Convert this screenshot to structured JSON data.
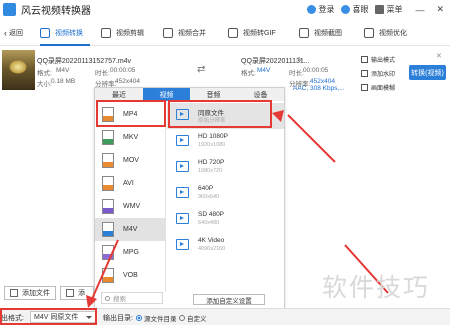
{
  "app": {
    "title": "风云视频转换器"
  },
  "titlebar": {
    "login": "登录",
    "favorites": "喜眼",
    "menu": "菜单",
    "minimize": "—",
    "close": "✕"
  },
  "toolbar": {
    "back": "返回",
    "tools": [
      {
        "label": "视频转换",
        "active": true
      },
      {
        "label": "视频剪辑",
        "active": false
      },
      {
        "label": "视频合并",
        "active": false
      },
      {
        "label": "视频转GIF",
        "active": false
      },
      {
        "label": "视频截图",
        "active": false
      },
      {
        "label": "视频优化",
        "active": false
      }
    ]
  },
  "file": {
    "src_name": "QQ录屏20220113152757.m4v",
    "src_format_label": "格式:",
    "src_format": "M4V",
    "src_duration_label": "时长:",
    "src_duration": "00:00:05",
    "src_size_label": "大小:",
    "src_size": "0.18 MB",
    "src_res_label": "分辨率:",
    "src_res": "452x404",
    "dst_name": "QQ录屏2022011131...",
    "dst_format_label": "格式:",
    "dst_format": "M4V",
    "dst_duration_label": "时长:",
    "dst_duration": "00:00:05",
    "dst_res_label": "分辨率:",
    "dst_res": "452x404",
    "dst_codec": "AAC, 308 Kbps,...",
    "actions": [
      "输出模式",
      "添加水印",
      "画面模糊"
    ],
    "convert_button": "转换(视频)"
  },
  "dialog": {
    "tabs": [
      {
        "label": "最近",
        "active": false
      },
      {
        "label": "视频",
        "active": true
      },
      {
        "label": "音频",
        "active": false
      },
      {
        "label": "设备",
        "active": false
      }
    ],
    "formats": [
      {
        "label": "MP4",
        "color": "#e88a2f",
        "selected": false
      },
      {
        "label": "MKV",
        "color": "#3f9c5c",
        "selected": false
      },
      {
        "label": "MOV",
        "color": "#e88a2f",
        "selected": false
      },
      {
        "label": "AVI",
        "color": "#e88a2f",
        "selected": false
      },
      {
        "label": "WMV",
        "color": "#7a5ac9",
        "selected": false
      },
      {
        "label": "M4V",
        "color": "#2b7fd9",
        "selected": true
      },
      {
        "label": "MPG",
        "color": "#8c6bd6",
        "selected": false
      },
      {
        "label": "VOB",
        "color": "#e88a2f",
        "selected": false
      }
    ],
    "resolutions": [
      {
        "name": "同原文件",
        "sub": "原始分辨率",
        "selected": true
      },
      {
        "name": "HD 1080P",
        "sub": "1920x1080",
        "selected": false
      },
      {
        "name": "HD 720P",
        "sub": "1080x720",
        "selected": false
      },
      {
        "name": "640P",
        "sub": "960x640",
        "selected": false
      },
      {
        "name": "SD 480P",
        "sub": "640x480",
        "selected": false
      },
      {
        "name": "4K Video",
        "sub": "4096x2160",
        "selected": false
      }
    ],
    "search_placeholder": "搜索",
    "add_custom": "添加自定义设置"
  },
  "bottom": {
    "add_file": "添加文件",
    "add_folder": "添",
    "output_format_label": "出格式:",
    "output_format_value": "M4V 同原文件",
    "output_dir_label": "输出目录:",
    "radio_source": "源文件目录",
    "radio_custom": "自定义"
  },
  "watermark": "软件技巧",
  "annotation_color": "#e53935"
}
